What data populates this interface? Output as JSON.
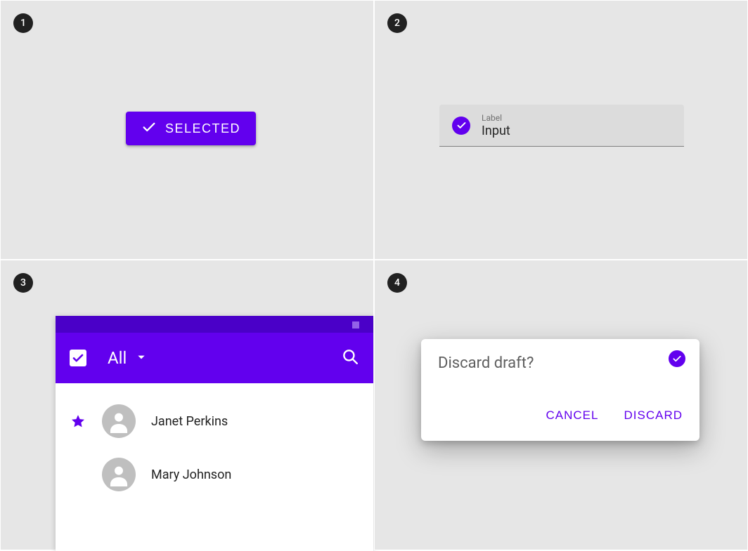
{
  "colors": {
    "primary": "#6200ee",
    "primaryDark": "#4a00c8",
    "surface": "#e6e6e6"
  },
  "badges": {
    "q1": "1",
    "q2": "2",
    "q3": "3",
    "q4": "4"
  },
  "q1": {
    "button_label": "SELECTED"
  },
  "q2": {
    "label": "Label",
    "value": "Input"
  },
  "q3": {
    "appbar_title": "All",
    "contacts": [
      {
        "name": "Janet Perkins",
        "starred": true
      },
      {
        "name": "Mary Johnson",
        "starred": false
      }
    ]
  },
  "q4": {
    "title": "Discard draft?",
    "cancel_label": "CANCEL",
    "discard_label": "DISCARD"
  },
  "icons": {
    "check": "check-icon",
    "checkbox": "checkbox-icon",
    "dropdown": "chevron-down-icon",
    "search": "search-icon",
    "star": "star-icon",
    "person": "person-icon"
  }
}
